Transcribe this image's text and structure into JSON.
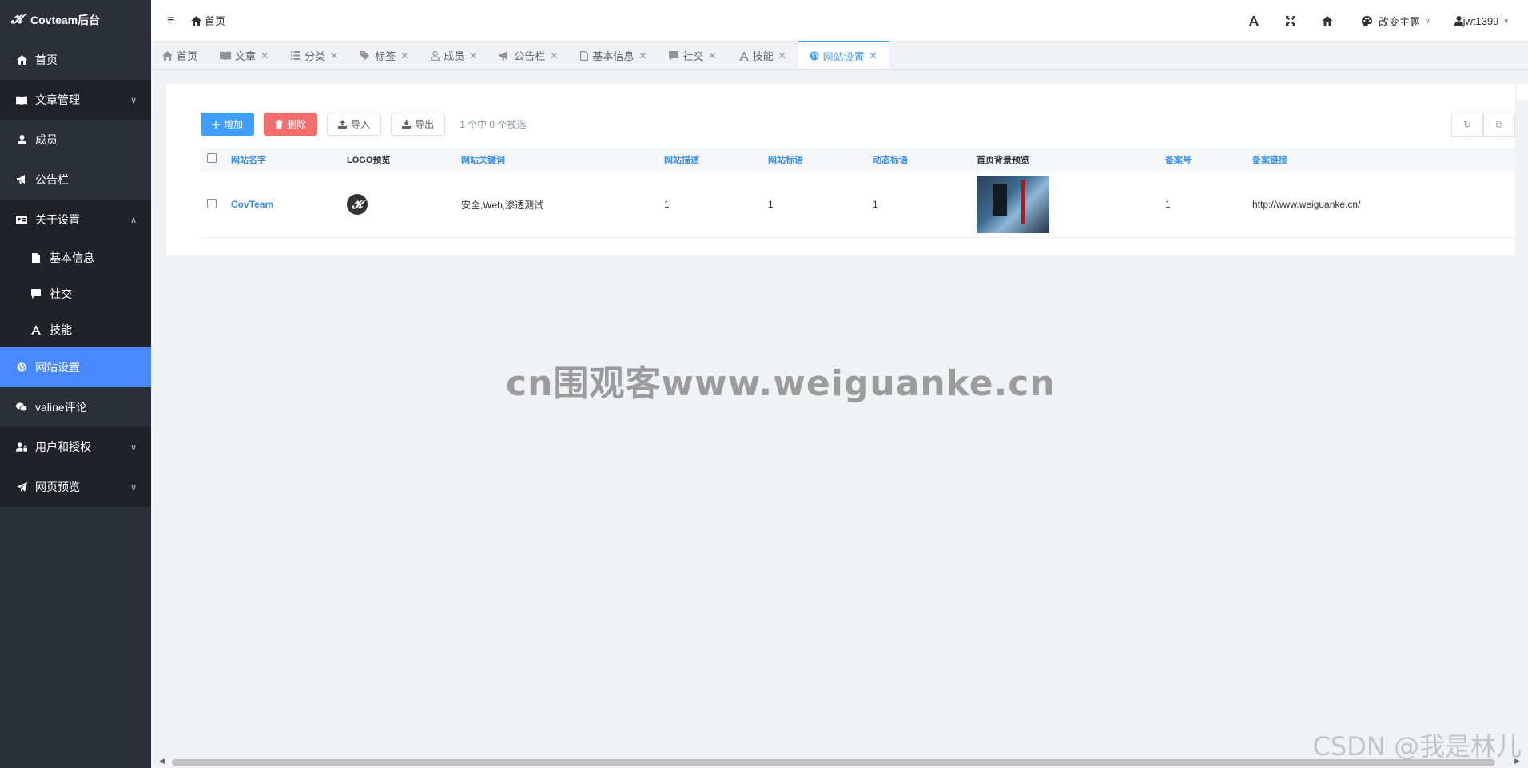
{
  "app": {
    "title": "Covteam后台"
  },
  "sidebar": {
    "items": [
      {
        "label": "首页"
      },
      {
        "label": "文章管理"
      },
      {
        "label": "成员"
      },
      {
        "label": "公告栏"
      },
      {
        "label": "关于设置"
      },
      {
        "label": "基本信息"
      },
      {
        "label": "社交"
      },
      {
        "label": "技能"
      },
      {
        "label": "网站设置"
      },
      {
        "label": "valine评论"
      },
      {
        "label": "用户和授权"
      },
      {
        "label": "网页预览"
      }
    ]
  },
  "header": {
    "breadcrumb": "首页",
    "theme_label": "改变主题",
    "username": "jwt1399"
  },
  "tabs": [
    {
      "label": "首页",
      "closable": false
    },
    {
      "label": "文章",
      "closable": true
    },
    {
      "label": "分类",
      "closable": true
    },
    {
      "label": "标签",
      "closable": true
    },
    {
      "label": "成员",
      "closable": true
    },
    {
      "label": "公告栏",
      "closable": true
    },
    {
      "label": "基本信息",
      "closable": true
    },
    {
      "label": "社交",
      "closable": true
    },
    {
      "label": "技能",
      "closable": true
    },
    {
      "label": "网站设置",
      "closable": true,
      "active": true
    }
  ],
  "toolbar": {
    "add_label": "增加",
    "delete_label": "删除",
    "import_label": "导入",
    "export_label": "导出",
    "selection_info": "1 个中 0 个被选"
  },
  "table": {
    "columns": [
      "网站名字",
      "LOGO预览",
      "网站关键词",
      "网站描述",
      "网站标语",
      "动态标语",
      "首页背景预览",
      "备案号",
      "备案链接"
    ],
    "rows": [
      {
        "name": "CovTeam",
        "keywords": "安全,Web,渗透测试",
        "description": "1",
        "slogan": "1",
        "dynamic_slogan": "1",
        "record_no": "1",
        "record_link": "http://www.weiguanke.cn/"
      }
    ]
  },
  "watermarks": {
    "center": "cn围观客www.weiguanke.cn",
    "corner": "CSDN @我是林儿"
  },
  "colors": {
    "sidebar_bg": "#2b2f3a",
    "sidebar_active": "#4a88ff",
    "primary": "#409eff",
    "danger": "#f56c6c"
  }
}
